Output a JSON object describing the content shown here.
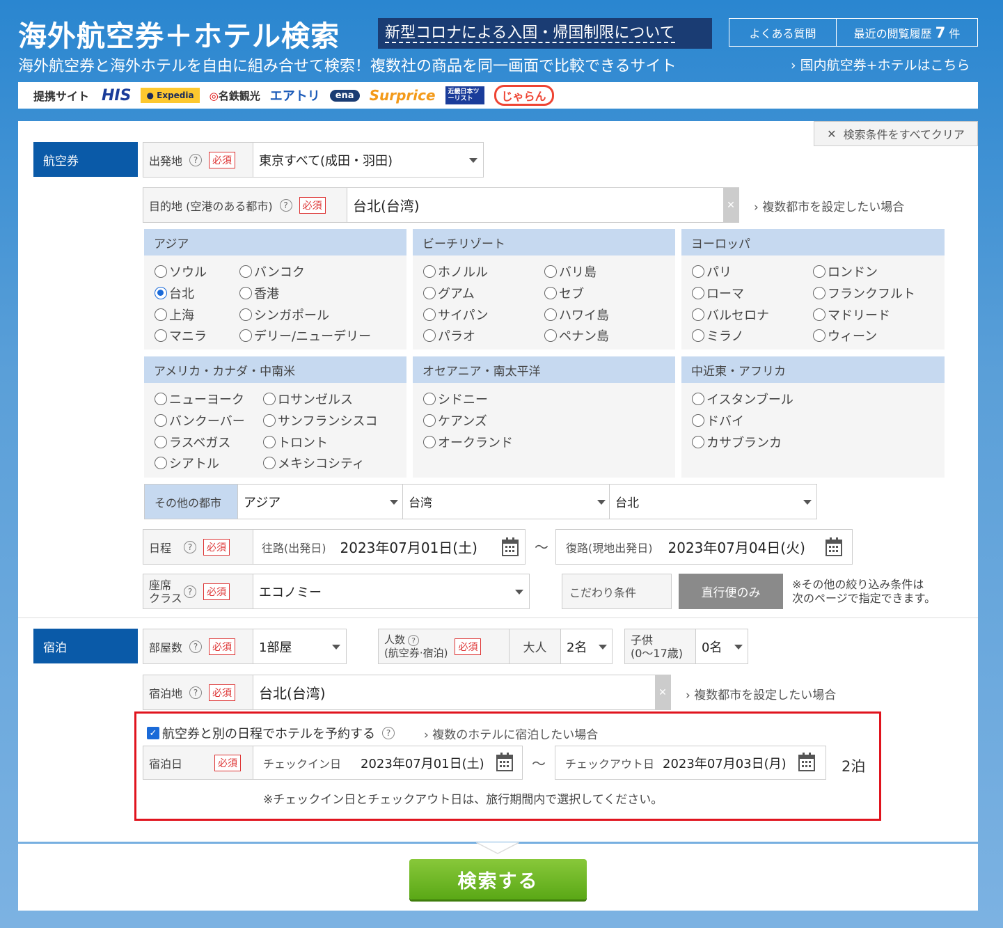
{
  "header": {
    "title": "海外航空券＋ホテル検索",
    "covid_link": "新型コロナによる入国・帰国制限について",
    "faq": "よくある質問",
    "history_label": "最近の閲覧履歴",
    "history_count": "7",
    "history_unit": "件",
    "subtitle": "海外航空券と海外ホテルを自由に組み合せて検索！複数社の商品を同一画面で比較できるサイト",
    "domestic_link": "国内航空券+ホテルはこちら"
  },
  "partners": {
    "label": "提携サイト",
    "logos": [
      "HIS",
      "Expedia",
      "名鉄観光",
      "エアトリ",
      "ena",
      "Surprice",
      "近畿日本ツーリスト",
      "じゃらん"
    ]
  },
  "clear_all": "検索条件をすべてクリア",
  "flight": {
    "tab": "航空券",
    "origin": {
      "label": "出発地",
      "required": "必須",
      "value": "東京すべて(成田・羽田)"
    },
    "destination": {
      "label": "目的地 (空港のある都市)",
      "required": "必須",
      "value": "台北(台湾)"
    },
    "multi_city_link": "複数都市を設定したい場合",
    "regions": [
      {
        "name": "アジア",
        "cities": [
          "ソウル",
          "バンコク",
          "台北",
          "香港",
          "上海",
          "シンガポール",
          "マニラ",
          "デリー/ニューデリー"
        ]
      },
      {
        "name": "ビーチリゾート",
        "cities": [
          "ホノルル",
          "バリ島",
          "グアム",
          "セブ",
          "サイパン",
          "ハワイ島",
          "パラオ",
          "ペナン島"
        ]
      },
      {
        "name": "ヨーロッパ",
        "cities": [
          "パリ",
          "ロンドン",
          "ローマ",
          "フランクフルト",
          "バルセロナ",
          "マドリード",
          "ミラノ",
          "ウィーン"
        ]
      },
      {
        "name": "アメリカ・カナダ・中南米",
        "cities": [
          "ニューヨーク",
          "ロサンゼルス",
          "バンクーバー",
          "サンフランシスコ",
          "ラスベガス",
          "トロント",
          "シアトル",
          "メキシコシティ"
        ]
      },
      {
        "name": "オセアニア・南太平洋",
        "cities": [
          "シドニー",
          "ケアンズ",
          "オークランド"
        ]
      },
      {
        "name": "中近東・アフリカ",
        "cities": [
          "イスタンブール",
          "ドバイ",
          "カサブランカ"
        ]
      }
    ],
    "selected_city": "台北",
    "other_cities": {
      "label": "その他の都市",
      "region": "アジア",
      "country": "台湾",
      "city": "台北"
    },
    "schedule": {
      "label": "日程",
      "required": "必須",
      "outbound_label": "往路(出発日)",
      "outbound_value": "2023年07月01日(土)",
      "separator": "～",
      "return_label": "復路(現地出発日)",
      "return_value": "2023年07月04日(火)"
    },
    "seat": {
      "label_line1": "座席",
      "label_line2": "クラス",
      "required": "必須",
      "value": "エコノミー"
    },
    "preference_label": "こだわり条件",
    "direct_only": "直行便のみ",
    "note_line1": "※その他の絞り込み条件は",
    "note_line2": "次のページで指定できます。"
  },
  "hotel": {
    "tab": "宿泊",
    "rooms": {
      "label": "部屋数",
      "required": "必須",
      "value": "1部屋"
    },
    "people": {
      "label_line1": "人数",
      "label_line2": "(航空券·宿泊)",
      "required": "必須",
      "adult_label": "大人",
      "adult_value": "2名",
      "child_label_line1": "子供",
      "child_label_line2": "(0～17歳)",
      "child_value": "0名"
    },
    "location": {
      "label": "宿泊地",
      "required": "必須",
      "value": "台北(台湾)"
    },
    "multi_city_link": "複数都市を設定したい場合",
    "separate_dates_label": "航空券と別の日程でホテルを予約する",
    "multi_hotel_link": "複数のホテルに宿泊したい場合",
    "stay": {
      "label": "宿泊日",
      "required": "必須",
      "checkin_label": "チェックイン日",
      "checkin_value": "2023年07月01日(土)",
      "separator": "～",
      "checkout_label": "チェックアウト日",
      "checkout_value": "2023年07月03日(月)",
      "nights": "2泊"
    },
    "note": "※チェックイン日とチェックアウト日は、旅行期間内で選択してください。"
  },
  "search_button": "検索する",
  "colors": {
    "primary": "#0a5aa8",
    "accent_green": "#5aa816",
    "highlight": "#e0141e"
  }
}
